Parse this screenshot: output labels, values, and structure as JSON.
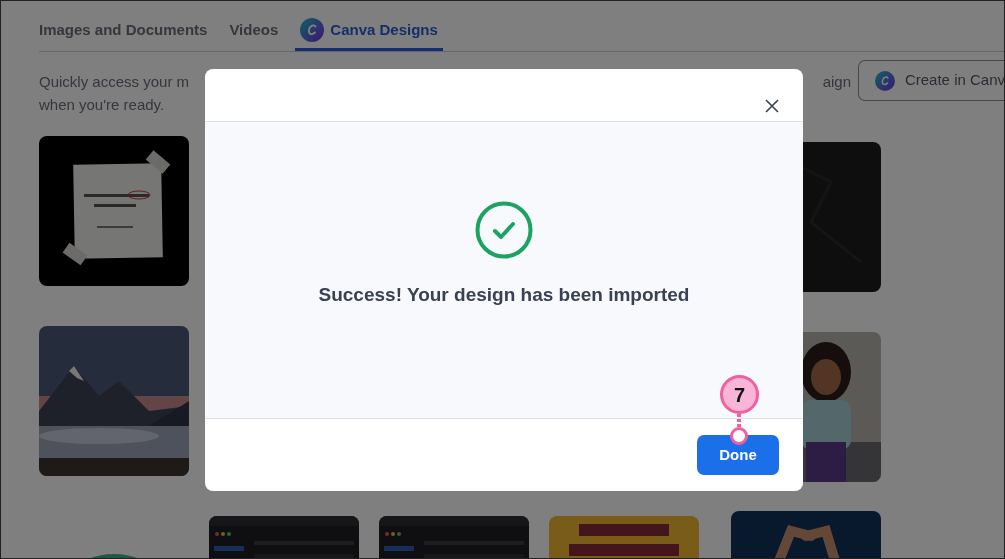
{
  "tabs": [
    {
      "label": "Images and Documents",
      "selected": false,
      "kind": "plain"
    },
    {
      "label": "Videos",
      "selected": false,
      "kind": "plain"
    },
    {
      "label": "Canva Designs",
      "selected": true,
      "kind": "logo"
    }
  ],
  "intro": {
    "first_line": "Quickly access your m",
    "right_fragment": "aign",
    "second_line": "when you're ready."
  },
  "create_button": {
    "label": "Create in Canv"
  },
  "modal": {
    "message": "Success! Your design has been imported",
    "button": "Done"
  },
  "callout": {
    "number": "7"
  }
}
